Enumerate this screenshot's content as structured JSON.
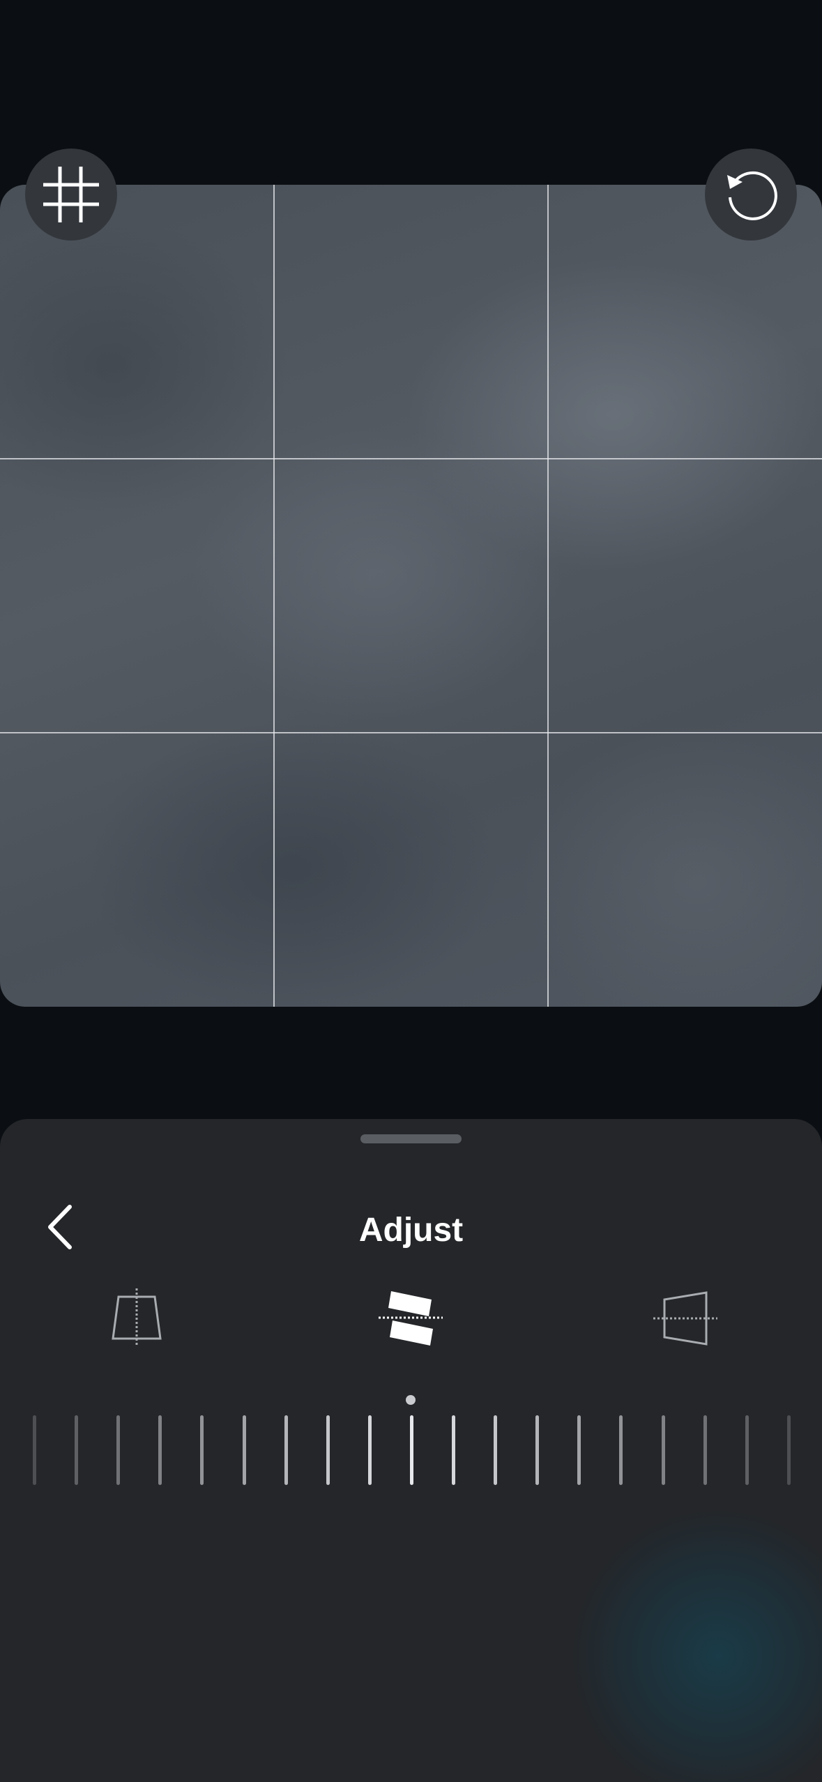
{
  "sheet": {
    "title": "Adjust"
  },
  "icons": {
    "grid_toggle": "grid-icon",
    "reset": "reset-rotate-icon",
    "back": "chevron-left-icon",
    "vertical_perspective": "vertical-perspective-icon",
    "straighten": "straighten-icon",
    "horizontal_perspective": "horizontal-perspective-icon"
  },
  "tools": {
    "selected": "straighten"
  },
  "dial": {
    "value": 0
  },
  "colors": {
    "background": "#0b0f13",
    "sheet": "#242629",
    "button": "#33373c",
    "accent_glow": "#164252"
  }
}
